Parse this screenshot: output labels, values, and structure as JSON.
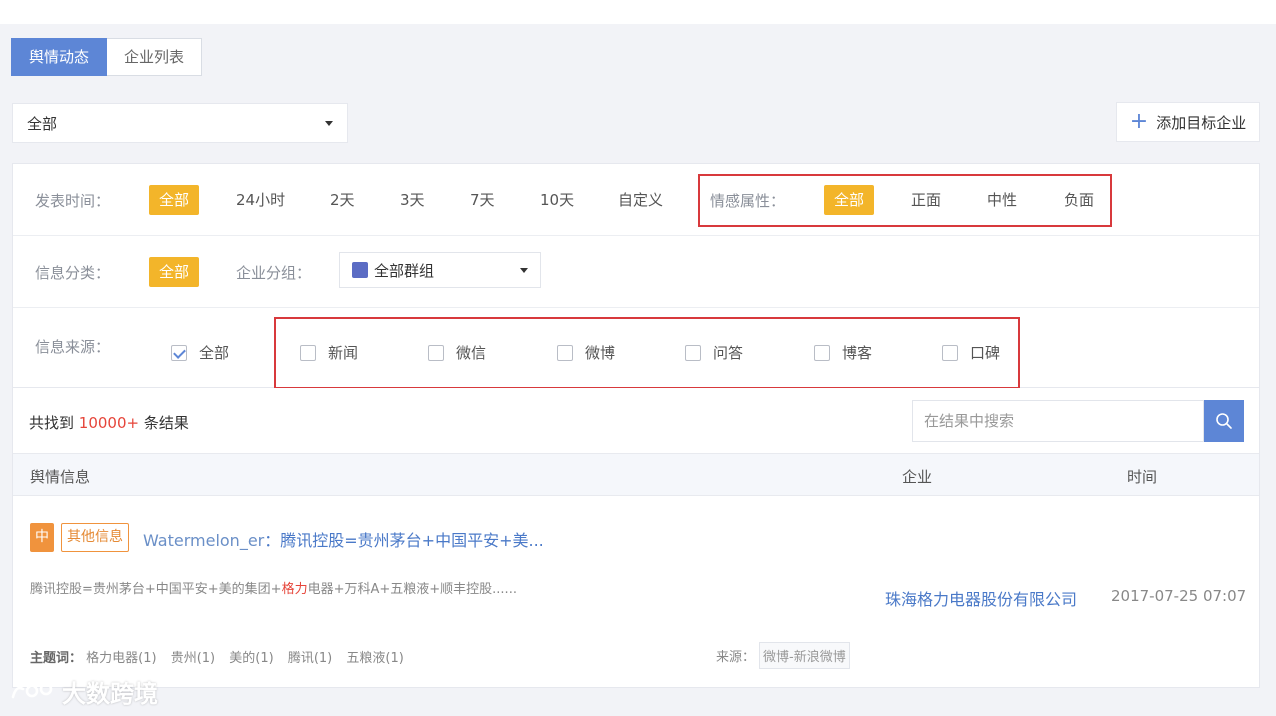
{
  "tabs": [
    {
      "label": "舆情动态",
      "active": true
    },
    {
      "label": "企业列表",
      "active": false
    }
  ],
  "company_select": {
    "value": "全部"
  },
  "add_button": {
    "label": "添加目标企业"
  },
  "filters": {
    "publish_time": {
      "label": "发表时间：",
      "options": [
        "全部",
        "24小时",
        "2天",
        "3天",
        "7天",
        "10天",
        "自定义"
      ],
      "selected": "全部"
    },
    "sentiment": {
      "label": "情感属性：",
      "options": [
        "全部",
        "正面",
        "中性",
        "负面"
      ],
      "selected": "全部"
    },
    "category": {
      "label": "信息分类：",
      "options": [
        "全部"
      ],
      "selected": "全部"
    },
    "group": {
      "label": "企业分组：",
      "value": "全部群组"
    },
    "source": {
      "label": "信息来源：",
      "options": [
        {
          "label": "全部",
          "checked": true
        },
        {
          "label": "新闻",
          "checked": false
        },
        {
          "label": "微信",
          "checked": false
        },
        {
          "label": "微博",
          "checked": false
        },
        {
          "label": "问答",
          "checked": false
        },
        {
          "label": "博客",
          "checked": false
        },
        {
          "label": "口碑",
          "checked": false
        }
      ]
    }
  },
  "results": {
    "prefix": "共找到",
    "count": "10000+",
    "suffix": "条结果",
    "search_placeholder": "在结果中搜索",
    "columns": [
      "舆情信息",
      "企业",
      "时间"
    ],
    "items": [
      {
        "sentiment_badge": "中",
        "type_badge": "其他信息",
        "author": "Watermelon_er",
        "title_sep": "：",
        "title": "腾讯控股=贵州茅台+中国平安+美...",
        "snippet_pre": "腾讯控股=贵州茅台+中国平安+美的集团+",
        "snippet_hl": "格力",
        "snippet_post": "电器+万科A+五粮液+顺丰控股......",
        "company": "珠海格力电器股份有限公司",
        "time": "2017-07-25 07:07",
        "keywords_label": "主题词：",
        "keywords": [
          "格力电器(1)",
          "贵州(1)",
          "美的(1)",
          "腾讯(1)",
          "五粮液(1)"
        ],
        "source_label": "来源：",
        "source": "微博-新浪微博"
      }
    ]
  },
  "watermark": {
    "text": "大数跨境"
  },
  "colors": {
    "accent": "#5d86d6",
    "selected": "#f3b52a",
    "highlight": "#e6453a",
    "badge": "#f0933d",
    "annotation": "#d8393c"
  }
}
